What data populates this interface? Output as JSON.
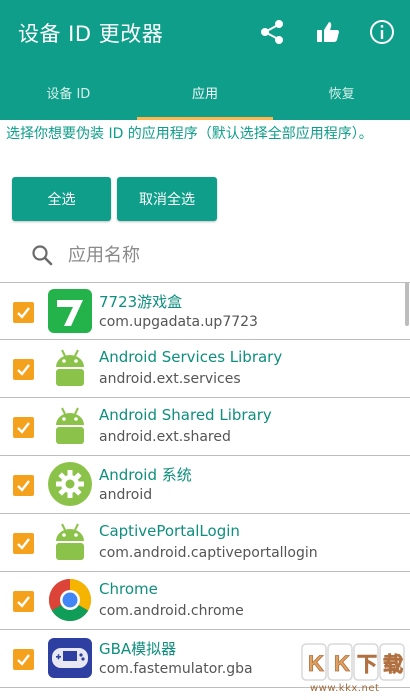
{
  "toolbar": {
    "title": "设备 ID 更改器",
    "icons": [
      "share-icon",
      "thumbs-up-icon",
      "info-icon"
    ]
  },
  "tabs": [
    {
      "label": "设备 ID",
      "active": false
    },
    {
      "label": "应用",
      "active": true
    },
    {
      "label": "恢复",
      "active": false
    }
  ],
  "hint": "选择你想要伪装 ID 的应用程序（默认选择全部应用程序）。",
  "buttons": {
    "select_all": "全选",
    "deselect_all": "取消全选"
  },
  "search": {
    "placeholder": "应用名称",
    "value": ""
  },
  "apps": [
    {
      "name": "7723游戏盒",
      "package": "com.upgadata.up7723",
      "icon": "app-7723-icon",
      "checked": true
    },
    {
      "name": "Android Services Library",
      "package": "android.ext.services",
      "icon": "android-robot-icon",
      "checked": true
    },
    {
      "name": "Android Shared Library",
      "package": "android.ext.shared",
      "icon": "android-robot-icon",
      "checked": true
    },
    {
      "name": "Android 系统",
      "package": "android",
      "icon": "android-gear-icon",
      "checked": true
    },
    {
      "name": "CaptivePortalLogin",
      "package": "com.android.captiveportallogin",
      "icon": "android-robot-icon",
      "checked": true
    },
    {
      "name": "Chrome",
      "package": "com.android.chrome",
      "icon": "chrome-icon",
      "checked": true
    },
    {
      "name": "GBA模拟器",
      "package": "com.fastemulator.gba",
      "icon": "gba-controller-icon",
      "checked": true
    }
  ],
  "colors": {
    "primary": "#0e9e8a",
    "accent": "#f4a21d",
    "tab_indicator": "#ffb74d"
  },
  "watermark": {
    "logo": "KK下载",
    "url": "www.kkx.net"
  }
}
